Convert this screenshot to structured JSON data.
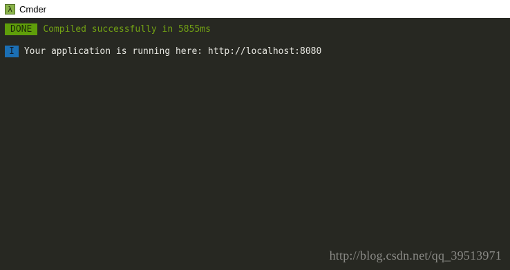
{
  "window": {
    "title": "Cmder",
    "icon": "lambda-icon",
    "icon_glyph": "λ"
  },
  "console": {
    "background": "#272822",
    "lines": [
      {
        "badge": "DONE",
        "badge_color": "#5f9e0a",
        "text": "Compiled successfully in 5855ms",
        "text_color": "#72a114"
      },
      {
        "badge": "I",
        "badge_color": "#1b6fb4",
        "text": "Your application is running here: http://localhost:8080",
        "text_color": "#e6e6e0"
      }
    ]
  },
  "watermark": "http://blog.csdn.net/qq_39513971"
}
